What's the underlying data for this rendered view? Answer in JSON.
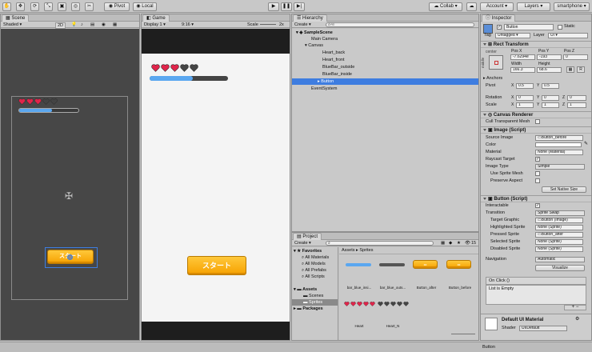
{
  "toolbar": {
    "pivot_label": "Pivot",
    "local_label": "Local",
    "collab_label": "Collab",
    "account_label": "Account",
    "layers_label": "Layers",
    "layout_label": "smartphone"
  },
  "scene": {
    "tab_label": "Scene",
    "shading": "Shaded",
    "mode_2d": "2D",
    "button_text": "スタート"
  },
  "game": {
    "tab_label": "Game",
    "display": "Display 1",
    "aspect": "9:16",
    "scale_label": "Scale",
    "scale_value": "2x",
    "button_text": "スタート",
    "hearts_full": 3,
    "hearts_total": 5,
    "bar_fill": 0.55
  },
  "hierarchy": {
    "tab_label": "Hierarchy",
    "create_label": "Create",
    "search_placeholder": "All",
    "items": [
      "SampleScene",
      "Main Camera",
      "Canvas",
      "Heart_back",
      "Heart_front",
      "BlueBar_outside",
      "BlueBar_inside",
      "Button",
      "EventSystem"
    ]
  },
  "project": {
    "tab_label": "Project",
    "create_label": "Create",
    "count": "15",
    "favorites_label": "Favorites",
    "favorites": [
      "All Materials",
      "All Models",
      "All Prefabs",
      "All Scripts"
    ],
    "assets_label": "Assets",
    "asset_folders": [
      "Scenes",
      "Sprites"
    ],
    "packages_label": "Packages",
    "breadcrumb_root": "Assets",
    "breadcrumb_current": "Sprites",
    "thumbs": [
      "bar_blue_insi...",
      "bar_blue_outs...",
      "Button_after",
      "Button_before",
      "Heart",
      "Heart_N"
    ]
  },
  "inspector": {
    "tab_label": "Inspector",
    "object_name": "Button",
    "static_label": "Static",
    "tag_label": "Tag",
    "tag_value": "Untagged",
    "layer_label": "Layer",
    "layer_value": "UI",
    "rect_transform": {
      "title": "Rect Transform",
      "anchor_label": "center",
      "side_label": "middle",
      "pos_x_label": "Pos X",
      "pos_y_label": "Pos Y",
      "pos_z_label": "Pos Z",
      "pos_x": "-7.6294e",
      "pos_y": "-193",
      "pos_z": "0",
      "width_label": "Width",
      "height_label": "Height",
      "width": "166.3",
      "height": "68.6",
      "anchors_label": "Anchors",
      "pivot_label": "Pivot",
      "pivot_x": "0.5",
      "pivot_y": "0.5",
      "rotation_label": "Rotation",
      "rot_x": "0",
      "rot_y": "0",
      "rot_z": "0",
      "scale_label": "Scale",
      "scale_x": "1",
      "scale_y": "1",
      "scale_z": "1"
    },
    "canvas_renderer": {
      "title": "Canvas Renderer",
      "cull_label": "Cull Transparent Mesh"
    },
    "image": {
      "title": "Image (Script)",
      "source_label": "Source Image",
      "source_value": "Button_before",
      "color_label": "Color",
      "material_label": "Material",
      "material_value": "None (Material)",
      "raycast_label": "Raycast Target",
      "type_label": "Image Type",
      "type_value": "Simple",
      "use_mesh_label": "Use Sprite Mesh",
      "preserve_label": "Preserve Aspect",
      "native_button": "Set Native Size"
    },
    "button": {
      "title": "Button (Script)",
      "interactable_label": "Interactable",
      "transition_label": "Transition",
      "transition_value": "Sprite Swap",
      "target_label": "Target Graphic",
      "target_value": "Button (Image)",
      "highlighted_label": "Highlighted Sprite",
      "highlighted_value": "None (Sprite)",
      "pressed_label": "Pressed Sprite",
      "pressed_value": "Button_after",
      "selected_label": "Selected Sprite",
      "selected_value": "None (Sprite)",
      "disabled_label": "Disabled Sprite",
      "disabled_value": "None (Sprite)",
      "navigation_label": "Navigation",
      "navigation_value": "Automatic",
      "visualize_button": "Visualize",
      "onclick_label": "On Click ()",
      "list_empty": "List is Empty"
    },
    "material": {
      "title": "Default UI Material",
      "shader_label": "Shader",
      "shader_value": "UI/Default"
    },
    "footer_label": "Button"
  },
  "colors": {
    "accent_blue": "#3e7de0",
    "heart_red": "#e0244a",
    "heart_empty": "#444444",
    "button_orange": "#f6a100",
    "bar_blue": "#5aa7f0"
  }
}
